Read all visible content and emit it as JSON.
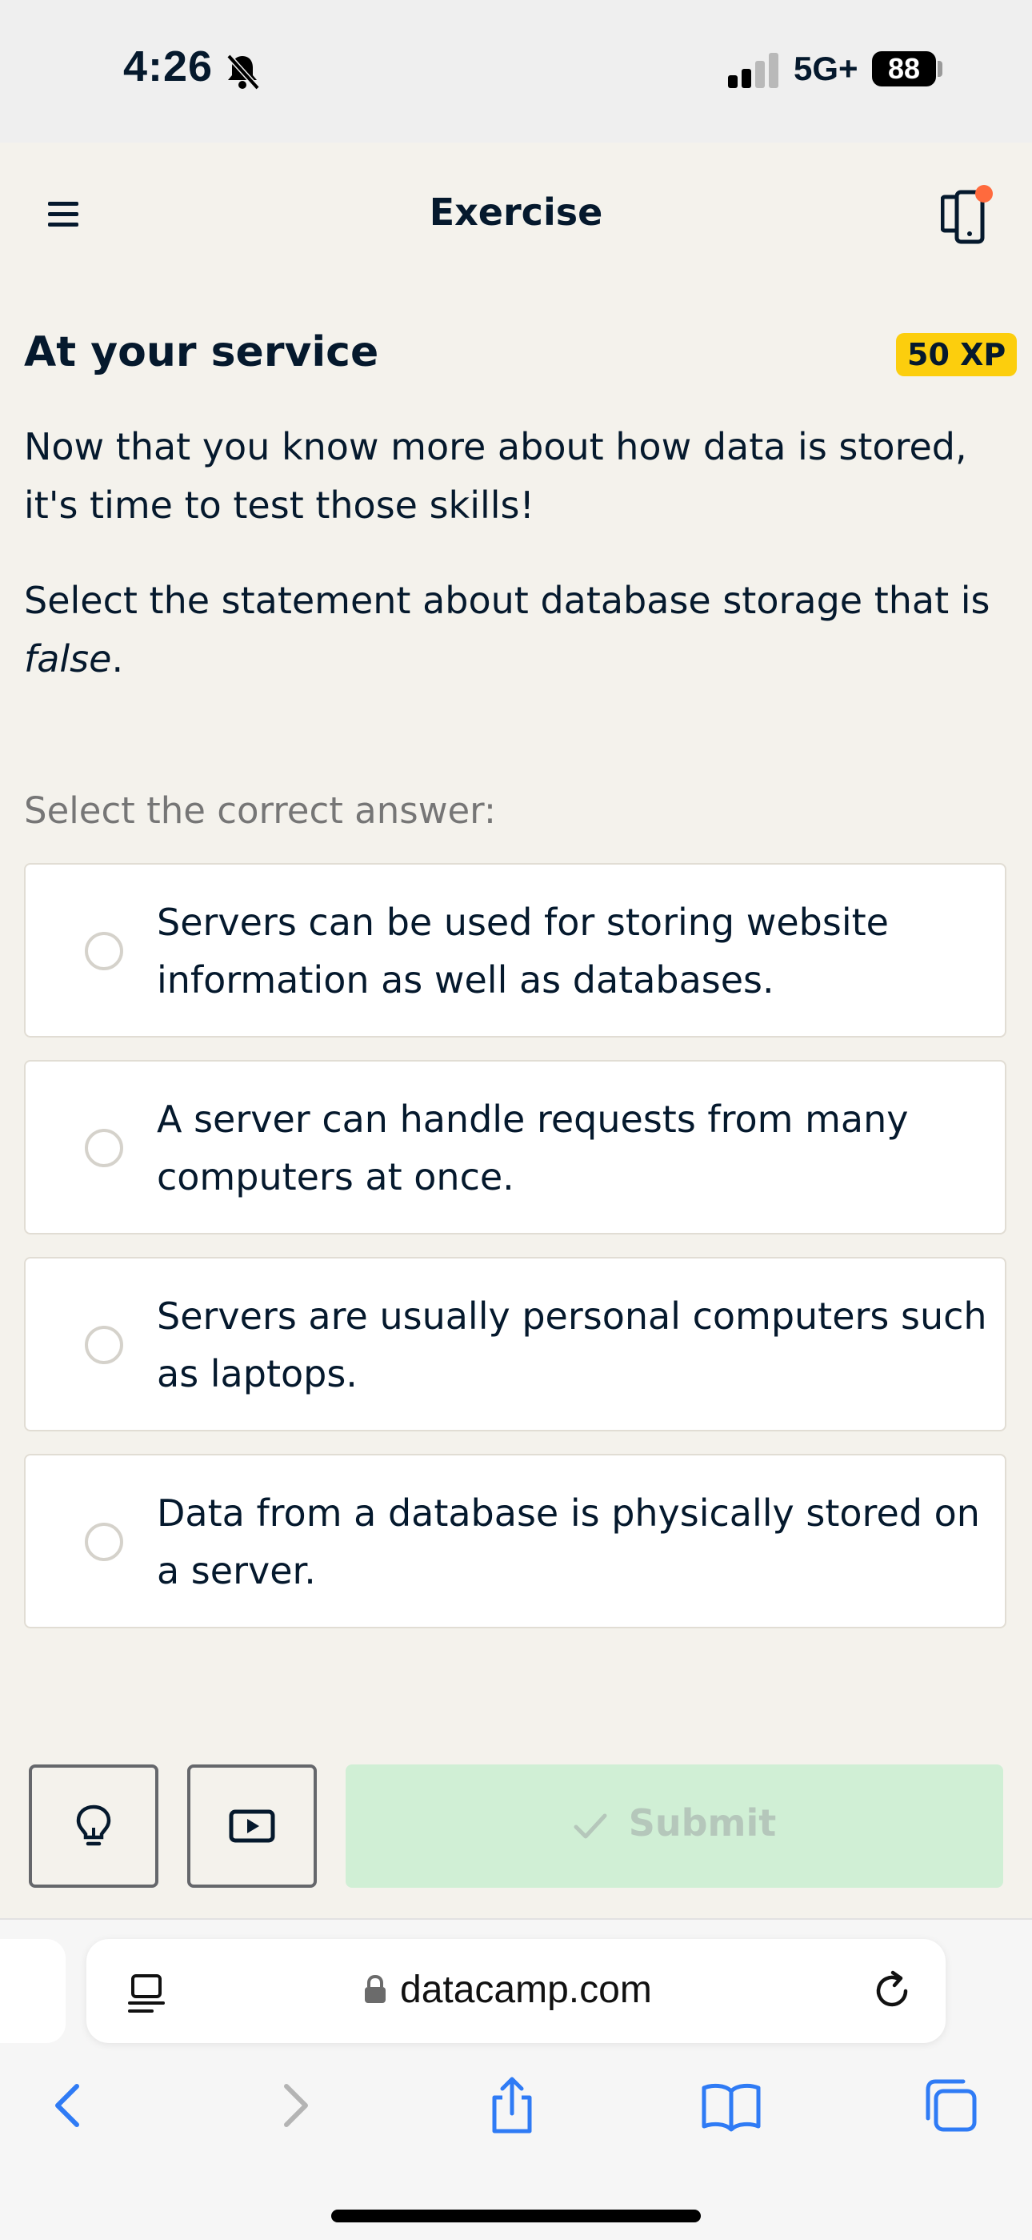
{
  "status_bar": {
    "time": "4:26",
    "network": "5G+",
    "battery": "88",
    "icons": [
      "bell-slash-icon",
      "signal-icon"
    ]
  },
  "app_bar": {
    "title": "Exercise",
    "icons": [
      "menu-icon",
      "mobile-device-icon"
    ],
    "notification_dot_color": "#ff6a3d"
  },
  "exercise": {
    "title": "At your service",
    "xp": "50 XP",
    "intro": "Now that you know more about how data is stored, it's time to test those skills!",
    "prompt_before": "Select the statement about database storage that is ",
    "prompt_emphasis": "false",
    "prompt_after": ".",
    "select_label": "Select the correct answer:",
    "options": [
      {
        "text": "Servers can be used for storing website information as well as databases.",
        "selected": false
      },
      {
        "text": "A server can handle requests from many computers at once.",
        "selected": false
      },
      {
        "text": "Servers are usually personal computers such as laptops.",
        "selected": false
      },
      {
        "text": "Data from a database is physically stored on a server.",
        "selected": false
      }
    ]
  },
  "actions": {
    "hint_icon": "lightbulb-icon",
    "video_icon": "play-video-icon",
    "submit_label": "Submit",
    "submit_enabled": false,
    "submit_color": "#d0efd5"
  },
  "browser": {
    "url": "datacamp.com",
    "toolbar_icons": [
      "back-icon",
      "forward-icon",
      "share-icon",
      "bookmarks-icon",
      "tabs-icon"
    ],
    "accent_color": "#2f7bf5"
  },
  "colors": {
    "background": "#f4f2ec",
    "text": "#05192d",
    "xp_badge": "#fcce0d"
  }
}
